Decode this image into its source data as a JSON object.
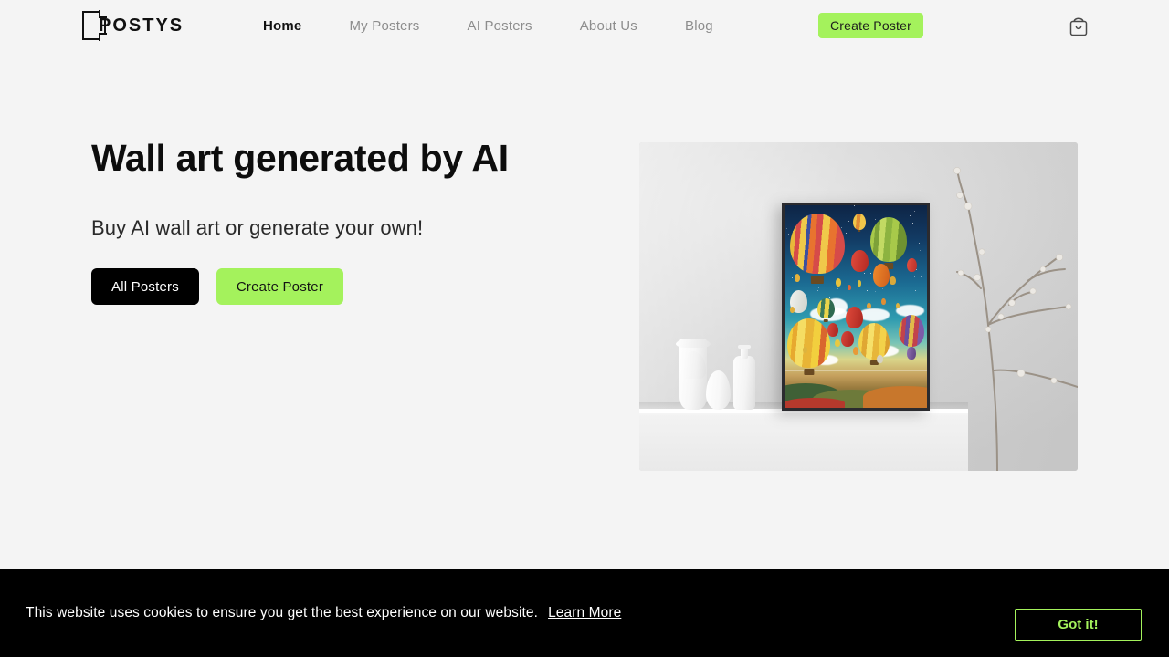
{
  "brand": {
    "name": "POSTYS",
    "logo_icon": "bracket-frame-logo"
  },
  "header": {
    "nav_items": [
      {
        "label": "Home",
        "active": true
      },
      {
        "label": "My Posters",
        "active": false
      },
      {
        "label": "AI Posters",
        "active": false
      },
      {
        "label": "About Us",
        "active": false
      },
      {
        "label": "Blog",
        "active": false
      }
    ],
    "cta_label": "Create Poster",
    "cart_icon": "shopping-bag-icon"
  },
  "hero": {
    "title": "Wall art generated by AI",
    "subtitle": "Buy AI wall art or generate your own!",
    "primary_button": "All Posters",
    "secondary_button": "Create Poster",
    "image_alt": "framed hot air balloon poster on shelf with vases and branch"
  },
  "cookies": {
    "message": "This website uses cookies to ensure you get the best experience on our website.",
    "learn_more": "Learn More",
    "accept_label": "Got it!"
  },
  "colors": {
    "accent_green": "#a4f25c",
    "page_background": "#f4f4f4",
    "text_dark": "#111111",
    "text_muted": "#8d8d8d",
    "banner_background": "#000000"
  }
}
